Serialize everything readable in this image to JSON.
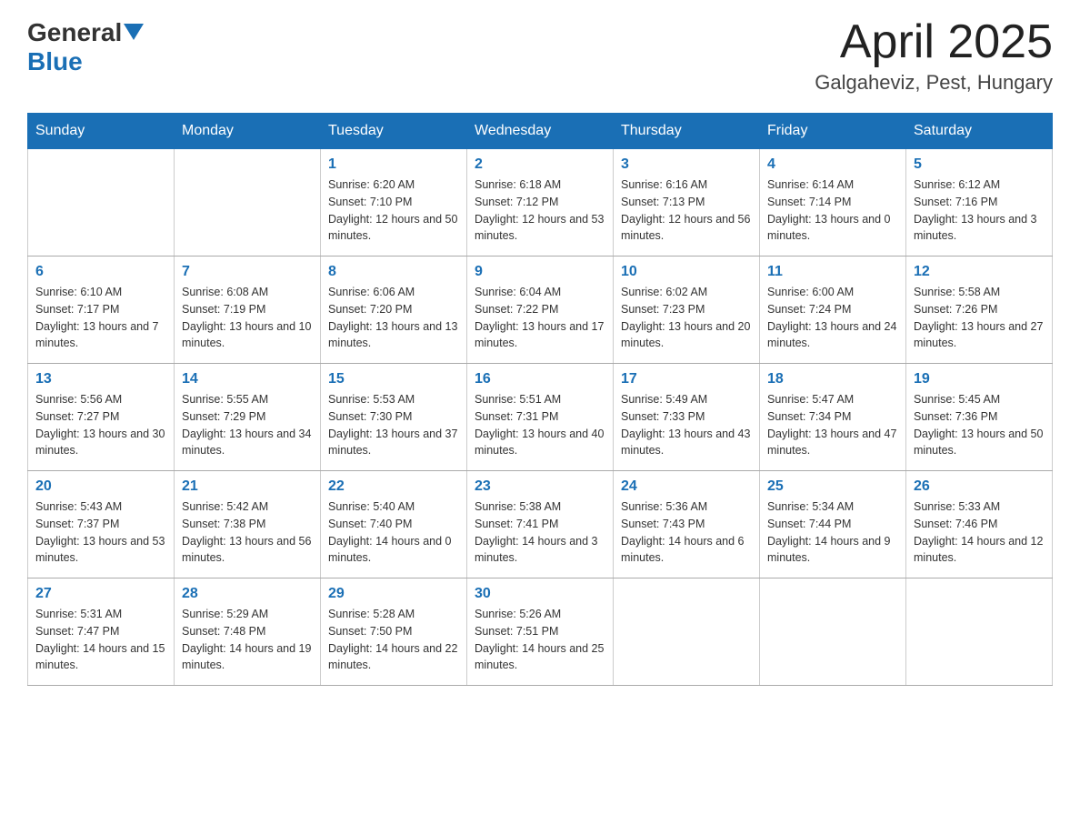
{
  "header": {
    "logo_general": "General",
    "logo_blue": "Blue",
    "month_title": "April 2025",
    "location": "Galgaheviz, Pest, Hungary"
  },
  "days_of_week": [
    "Sunday",
    "Monday",
    "Tuesday",
    "Wednesday",
    "Thursday",
    "Friday",
    "Saturday"
  ],
  "weeks": [
    [
      {
        "day": "",
        "sunrise": "",
        "sunset": "",
        "daylight": ""
      },
      {
        "day": "",
        "sunrise": "",
        "sunset": "",
        "daylight": ""
      },
      {
        "day": "1",
        "sunrise": "Sunrise: 6:20 AM",
        "sunset": "Sunset: 7:10 PM",
        "daylight": "Daylight: 12 hours and 50 minutes."
      },
      {
        "day": "2",
        "sunrise": "Sunrise: 6:18 AM",
        "sunset": "Sunset: 7:12 PM",
        "daylight": "Daylight: 12 hours and 53 minutes."
      },
      {
        "day": "3",
        "sunrise": "Sunrise: 6:16 AM",
        "sunset": "Sunset: 7:13 PM",
        "daylight": "Daylight: 12 hours and 56 minutes."
      },
      {
        "day": "4",
        "sunrise": "Sunrise: 6:14 AM",
        "sunset": "Sunset: 7:14 PM",
        "daylight": "Daylight: 13 hours and 0 minutes."
      },
      {
        "day": "5",
        "sunrise": "Sunrise: 6:12 AM",
        "sunset": "Sunset: 7:16 PM",
        "daylight": "Daylight: 13 hours and 3 minutes."
      }
    ],
    [
      {
        "day": "6",
        "sunrise": "Sunrise: 6:10 AM",
        "sunset": "Sunset: 7:17 PM",
        "daylight": "Daylight: 13 hours and 7 minutes."
      },
      {
        "day": "7",
        "sunrise": "Sunrise: 6:08 AM",
        "sunset": "Sunset: 7:19 PM",
        "daylight": "Daylight: 13 hours and 10 minutes."
      },
      {
        "day": "8",
        "sunrise": "Sunrise: 6:06 AM",
        "sunset": "Sunset: 7:20 PM",
        "daylight": "Daylight: 13 hours and 13 minutes."
      },
      {
        "day": "9",
        "sunrise": "Sunrise: 6:04 AM",
        "sunset": "Sunset: 7:22 PM",
        "daylight": "Daylight: 13 hours and 17 minutes."
      },
      {
        "day": "10",
        "sunrise": "Sunrise: 6:02 AM",
        "sunset": "Sunset: 7:23 PM",
        "daylight": "Daylight: 13 hours and 20 minutes."
      },
      {
        "day": "11",
        "sunrise": "Sunrise: 6:00 AM",
        "sunset": "Sunset: 7:24 PM",
        "daylight": "Daylight: 13 hours and 24 minutes."
      },
      {
        "day": "12",
        "sunrise": "Sunrise: 5:58 AM",
        "sunset": "Sunset: 7:26 PM",
        "daylight": "Daylight: 13 hours and 27 minutes."
      }
    ],
    [
      {
        "day": "13",
        "sunrise": "Sunrise: 5:56 AM",
        "sunset": "Sunset: 7:27 PM",
        "daylight": "Daylight: 13 hours and 30 minutes."
      },
      {
        "day": "14",
        "sunrise": "Sunrise: 5:55 AM",
        "sunset": "Sunset: 7:29 PM",
        "daylight": "Daylight: 13 hours and 34 minutes."
      },
      {
        "day": "15",
        "sunrise": "Sunrise: 5:53 AM",
        "sunset": "Sunset: 7:30 PM",
        "daylight": "Daylight: 13 hours and 37 minutes."
      },
      {
        "day": "16",
        "sunrise": "Sunrise: 5:51 AM",
        "sunset": "Sunset: 7:31 PM",
        "daylight": "Daylight: 13 hours and 40 minutes."
      },
      {
        "day": "17",
        "sunrise": "Sunrise: 5:49 AM",
        "sunset": "Sunset: 7:33 PM",
        "daylight": "Daylight: 13 hours and 43 minutes."
      },
      {
        "day": "18",
        "sunrise": "Sunrise: 5:47 AM",
        "sunset": "Sunset: 7:34 PM",
        "daylight": "Daylight: 13 hours and 47 minutes."
      },
      {
        "day": "19",
        "sunrise": "Sunrise: 5:45 AM",
        "sunset": "Sunset: 7:36 PM",
        "daylight": "Daylight: 13 hours and 50 minutes."
      }
    ],
    [
      {
        "day": "20",
        "sunrise": "Sunrise: 5:43 AM",
        "sunset": "Sunset: 7:37 PM",
        "daylight": "Daylight: 13 hours and 53 minutes."
      },
      {
        "day": "21",
        "sunrise": "Sunrise: 5:42 AM",
        "sunset": "Sunset: 7:38 PM",
        "daylight": "Daylight: 13 hours and 56 minutes."
      },
      {
        "day": "22",
        "sunrise": "Sunrise: 5:40 AM",
        "sunset": "Sunset: 7:40 PM",
        "daylight": "Daylight: 14 hours and 0 minutes."
      },
      {
        "day": "23",
        "sunrise": "Sunrise: 5:38 AM",
        "sunset": "Sunset: 7:41 PM",
        "daylight": "Daylight: 14 hours and 3 minutes."
      },
      {
        "day": "24",
        "sunrise": "Sunrise: 5:36 AM",
        "sunset": "Sunset: 7:43 PM",
        "daylight": "Daylight: 14 hours and 6 minutes."
      },
      {
        "day": "25",
        "sunrise": "Sunrise: 5:34 AM",
        "sunset": "Sunset: 7:44 PM",
        "daylight": "Daylight: 14 hours and 9 minutes."
      },
      {
        "day": "26",
        "sunrise": "Sunrise: 5:33 AM",
        "sunset": "Sunset: 7:46 PM",
        "daylight": "Daylight: 14 hours and 12 minutes."
      }
    ],
    [
      {
        "day": "27",
        "sunrise": "Sunrise: 5:31 AM",
        "sunset": "Sunset: 7:47 PM",
        "daylight": "Daylight: 14 hours and 15 minutes."
      },
      {
        "day": "28",
        "sunrise": "Sunrise: 5:29 AM",
        "sunset": "Sunset: 7:48 PM",
        "daylight": "Daylight: 14 hours and 19 minutes."
      },
      {
        "day": "29",
        "sunrise": "Sunrise: 5:28 AM",
        "sunset": "Sunset: 7:50 PM",
        "daylight": "Daylight: 14 hours and 22 minutes."
      },
      {
        "day": "30",
        "sunrise": "Sunrise: 5:26 AM",
        "sunset": "Sunset: 7:51 PM",
        "daylight": "Daylight: 14 hours and 25 minutes."
      },
      {
        "day": "",
        "sunrise": "",
        "sunset": "",
        "daylight": ""
      },
      {
        "day": "",
        "sunrise": "",
        "sunset": "",
        "daylight": ""
      },
      {
        "day": "",
        "sunrise": "",
        "sunset": "",
        "daylight": ""
      }
    ]
  ]
}
